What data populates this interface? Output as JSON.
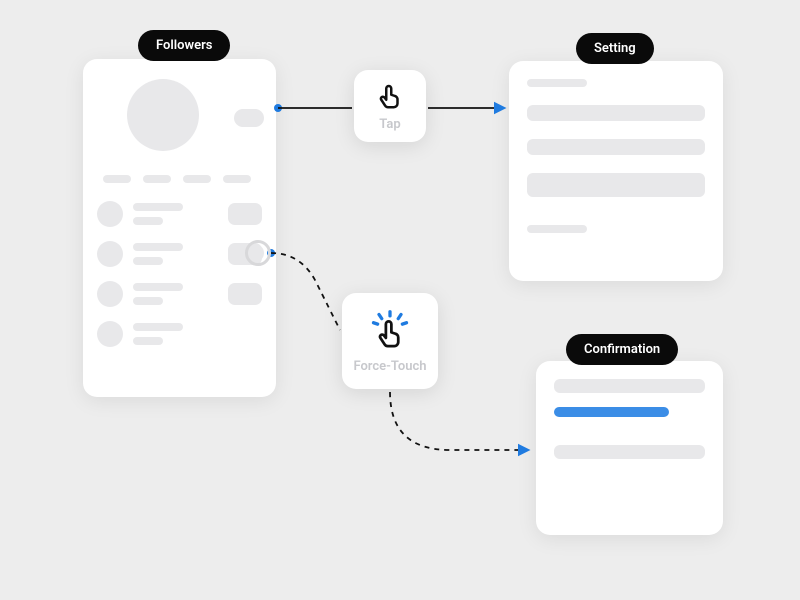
{
  "labels": {
    "followers": "Followers",
    "setting": "Setting",
    "confirmation": "Confirmation"
  },
  "gestures": {
    "tap": "Tap",
    "force_touch": "Force-Touch"
  },
  "colors": {
    "accent": "#1f7be0",
    "highlight": "#3b8de6",
    "pill_bg": "#0a0a0a",
    "skeleton": "#e8e8ea",
    "canvas": "#ededed"
  }
}
